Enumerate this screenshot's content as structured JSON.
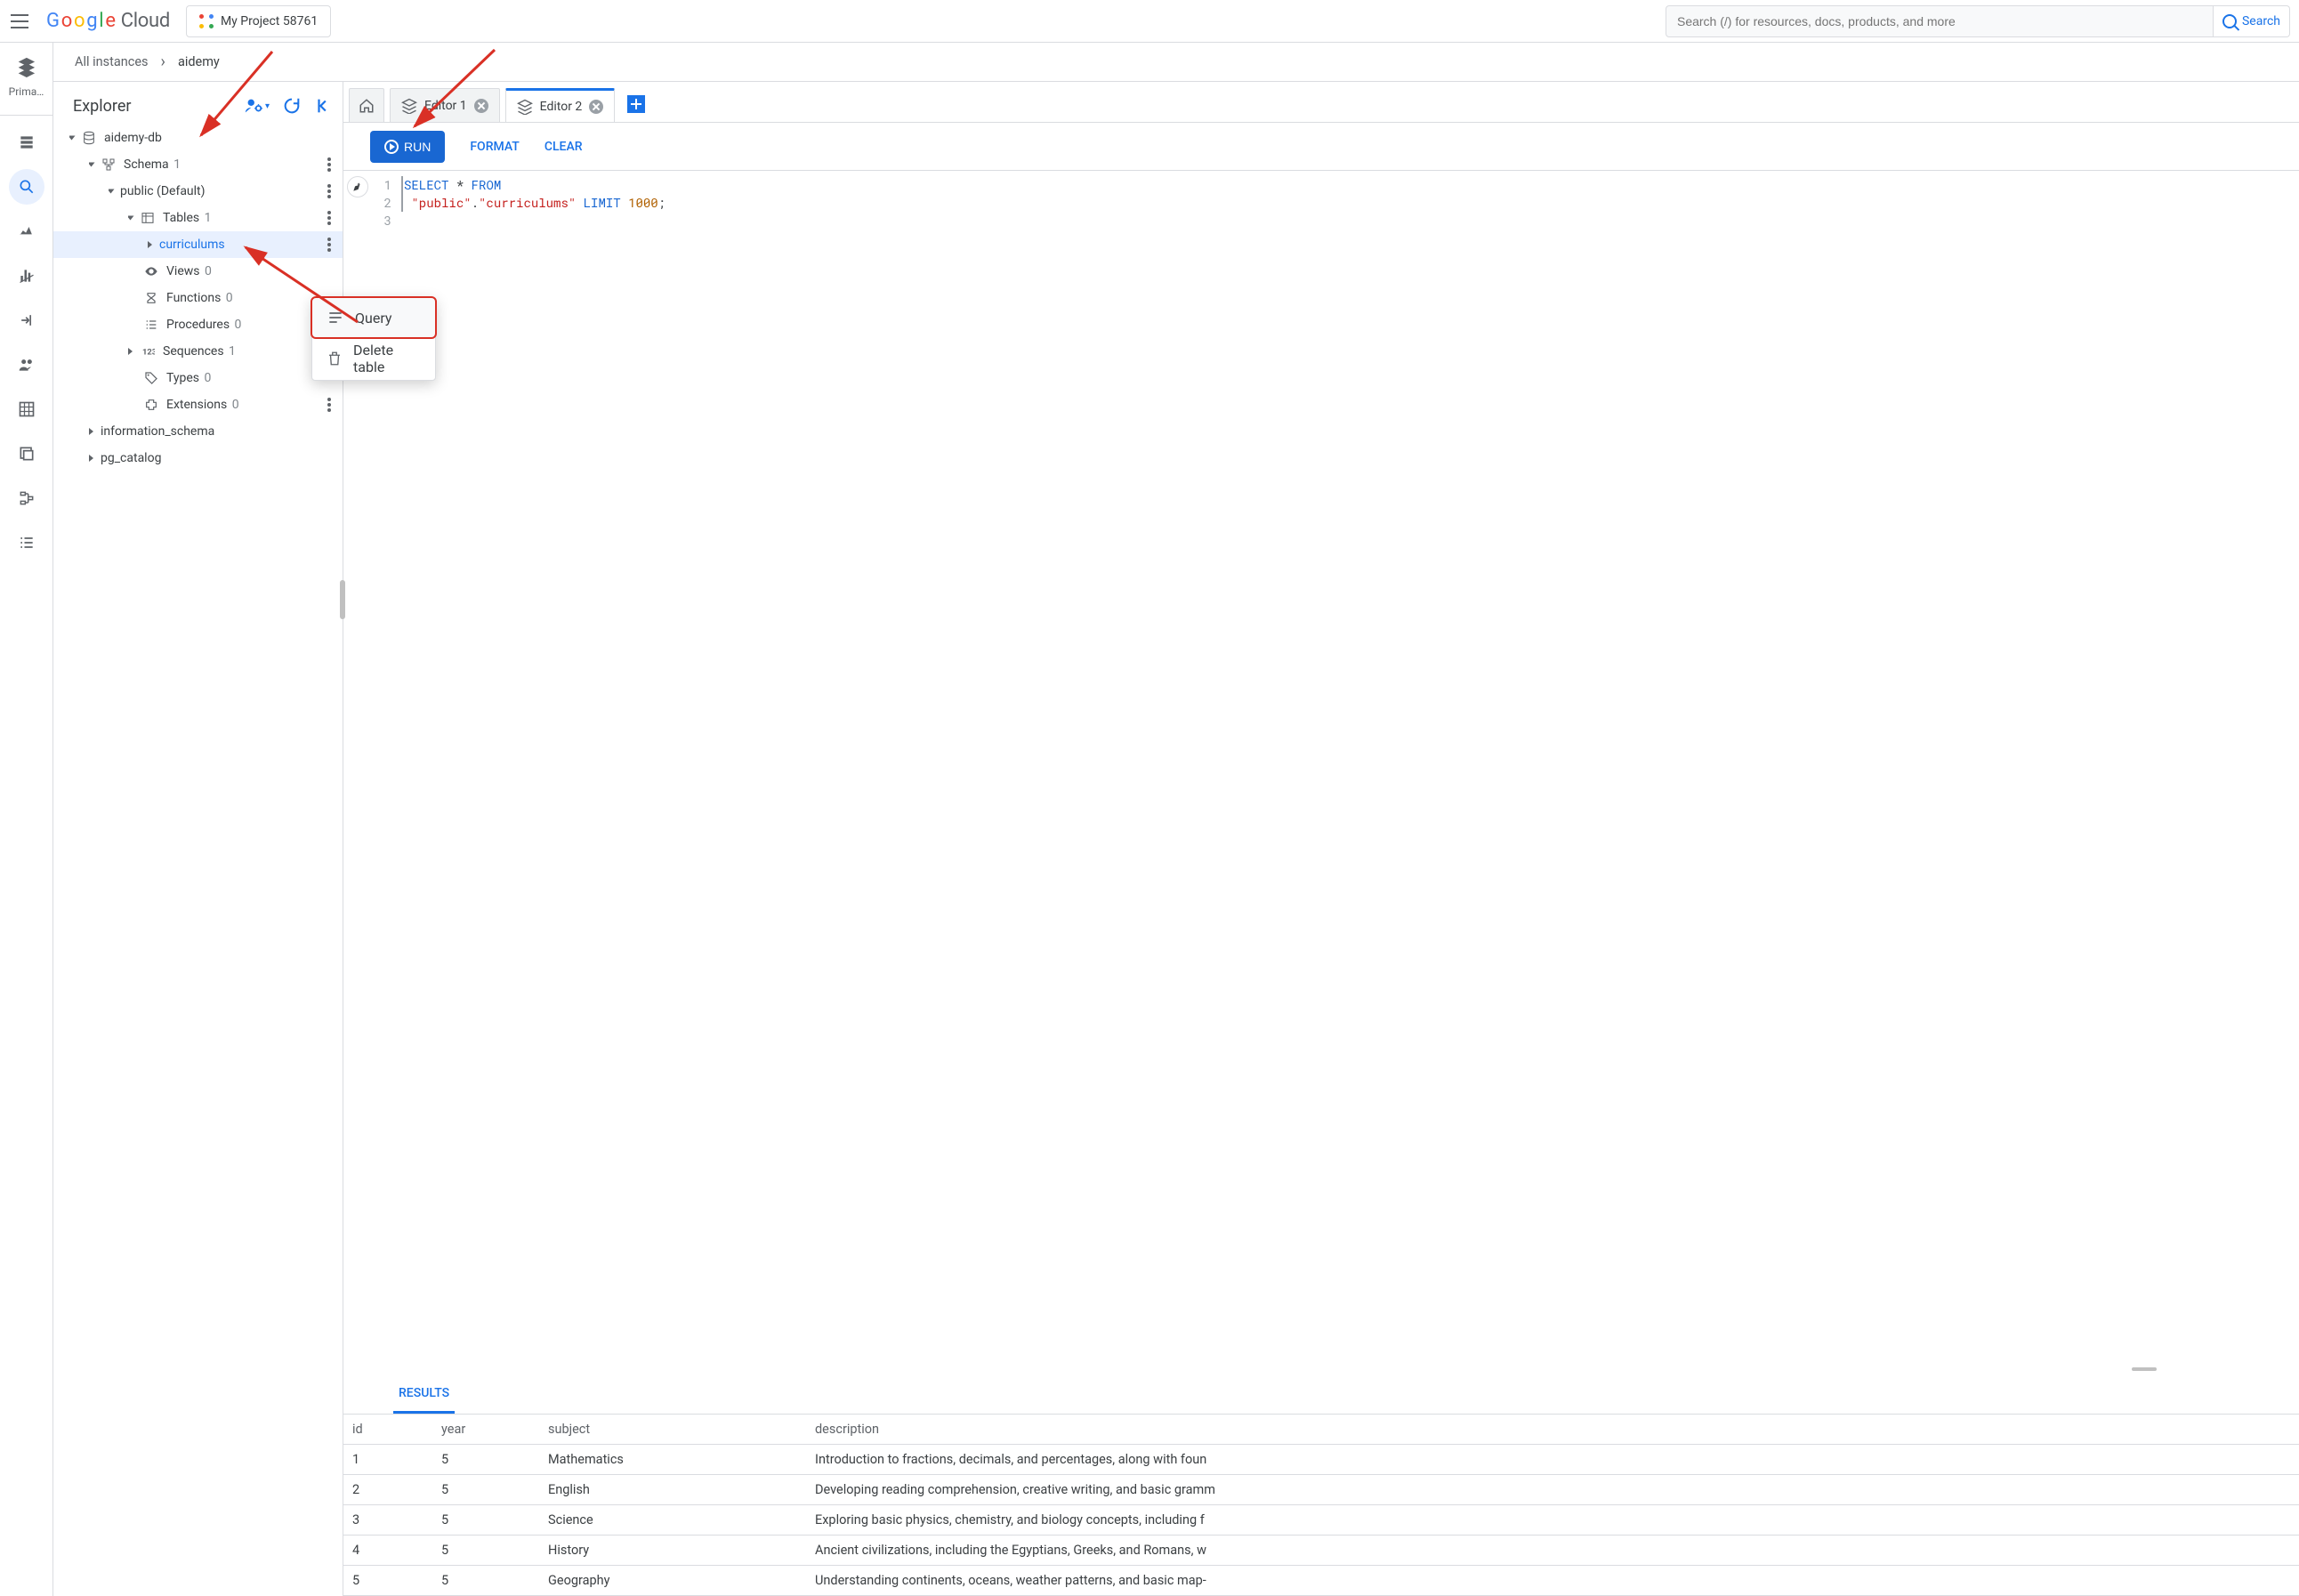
{
  "header": {
    "logo_cloud": "Cloud",
    "project": "My Project 58761",
    "search_placeholder": "Search (/) for resources, docs, products, and more",
    "search_button": "Search"
  },
  "rail": {
    "primary_label": "Prima…"
  },
  "breadcrumb": {
    "root": "All instances",
    "leaf": "aidemy"
  },
  "explorer": {
    "title": "Explorer",
    "db": "aidemy-db",
    "schema_label": "Schema",
    "schema_count": "1",
    "public_label": "public (Default)",
    "tables_label": "Tables",
    "tables_count": "1",
    "table_curriculums": "curriculums",
    "views_label": "Views",
    "views_count": "0",
    "functions_label": "Functions",
    "functions_count": "0",
    "procedures_label": "Procedures",
    "procedures_count": "0",
    "sequences_label": "Sequences",
    "sequences_count": "1",
    "types_label": "Types",
    "types_count": "0",
    "extensions_label": "Extensions",
    "extensions_count": "0",
    "information_schema": "information_schema",
    "pg_catalog": "pg_catalog"
  },
  "context_menu": {
    "query": "Query",
    "delete": "Delete table"
  },
  "tabs": {
    "editor1": "Editor 1",
    "editor2": "Editor 2"
  },
  "toolbar": {
    "run": "RUN",
    "format": "FORMAT",
    "clear": "CLEAR"
  },
  "sql": {
    "line1a": "SELECT",
    "line1b": " * ",
    "line1c": "FROM",
    "line2_public": "\"public\"",
    "line2_dot": ".",
    "line2_curr": "\"curriculums\"",
    "line2_limit": " LIMIT ",
    "line2_num": "1000",
    "line2_semi": ";"
  },
  "results": {
    "tab": "RESULTS",
    "columns": [
      "id",
      "year",
      "subject",
      "description"
    ],
    "rows": [
      {
        "id": "1",
        "year": "5",
        "subject": "Mathematics",
        "description": "Introduction to fractions, decimals, and percentages, along with foun"
      },
      {
        "id": "2",
        "year": "5",
        "subject": "English",
        "description": "Developing reading comprehension, creative writing, and basic gramm"
      },
      {
        "id": "3",
        "year": "5",
        "subject": "Science",
        "description": "Exploring basic physics, chemistry, and biology concepts, including f"
      },
      {
        "id": "4",
        "year": "5",
        "subject": "History",
        "description": "Ancient civilizations, including the Egyptians, Greeks, and Romans, w"
      },
      {
        "id": "5",
        "year": "5",
        "subject": "Geography",
        "description": "Understanding continents, oceans, weather patterns, and basic map-"
      }
    ]
  }
}
